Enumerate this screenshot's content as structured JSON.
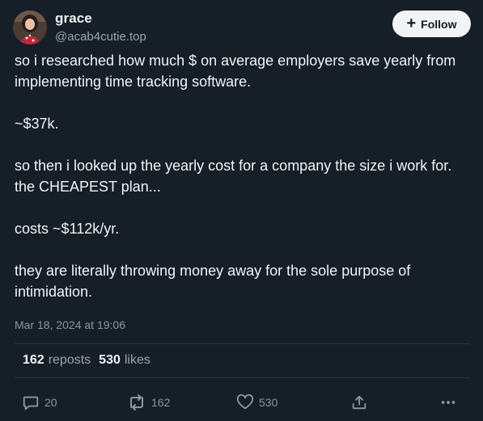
{
  "author": {
    "name": "grace",
    "handle": "@acab4cutie.top"
  },
  "follow_label": "Follow",
  "post": {
    "paragraphs": [
      "so i researched how much $ on average employers save yearly from implementing time tracking software.",
      "~$37k.",
      "so then i looked up the yearly cost for a company the size i work for. the CHEAPEST plan...",
      "costs ~$112k/yr.",
      "they are literally throwing money away for the sole purpose of intimidation."
    ],
    "timestamp": "Mar 18, 2024 at 19:06"
  },
  "stats": {
    "reposts_count": "162",
    "reposts_label": "reposts",
    "likes_count": "530",
    "likes_label": "likes"
  },
  "actions": {
    "reply_count": "20",
    "repost_count": "162",
    "like_count": "530"
  },
  "icons": {
    "reply": "speech-bubble-icon",
    "repost": "repost-arrows-icon",
    "like": "heart-icon",
    "share": "share-upload-icon",
    "more": "more-dots-icon"
  },
  "colors": {
    "background": "#161e27",
    "text": "#f1f3f5",
    "muted": "#8b97a4",
    "follow_bg": "#f1f3f5"
  }
}
